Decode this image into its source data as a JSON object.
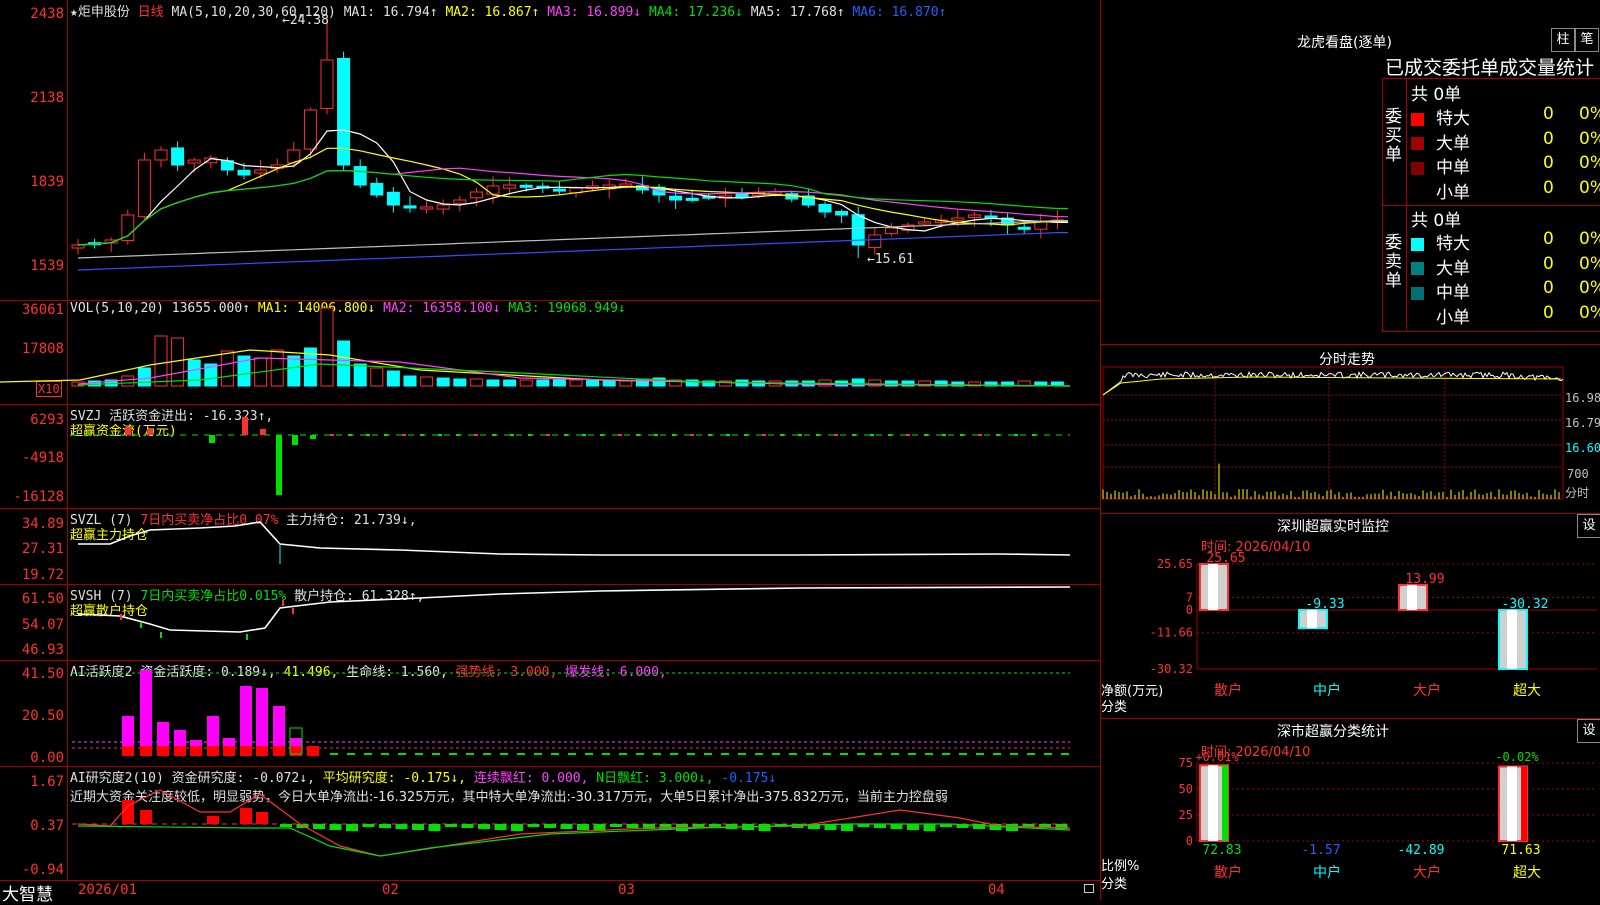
{
  "stock": {
    "name": "炬申股份",
    "period": "日线"
  },
  "kline": {
    "yticks": [
      "2438",
      "2138",
      "1839",
      "1539"
    ],
    "ma_params": "MA(5,10,20,30,60,120)",
    "ma1": "MA1: 16.794↑",
    "ma2": "MA2: 16.867↑",
    "ma3": "MA3: 16.899↓",
    "ma4": "MA4: 17.236↓",
    "ma5": "MA5: 17.768↑",
    "ma6": "MA6: 16.870↑",
    "high_label": "24.38",
    "low_label": "15.61"
  },
  "vol": {
    "yticks": [
      "36061",
      "17808"
    ],
    "unit": "X10",
    "params": "VOL(5,10,20)",
    "val": "13655.000↑",
    "ma1": "MA1: 14006.800↓",
    "ma2": "MA2: 16358.100↓",
    "ma3": "MA3: 19068.949↓"
  },
  "svzj": {
    "yticks": [
      "6293",
      "-4918",
      "-16128"
    ],
    "title": "SVZJ",
    "desc": "活跃资金进出: -16.323↑,",
    "label": "超赢资金流(万元)"
  },
  "svzl": {
    "yticks": [
      "34.89",
      "27.31",
      "19.72"
    ],
    "title": "SVZL (7)",
    "ratio": "7日内买卖净占比0.07%",
    "hold": "主力持仓: 21.739↓,",
    "label": "超赢主力持仓"
  },
  "svsh": {
    "yticks": [
      "61.50",
      "54.07",
      "46.93"
    ],
    "title": "SVSH (7)",
    "ratio": "7日内买卖净占比0.015%",
    "hold": "散户持仓: 61.328↑,",
    "label": "超赢散户持仓"
  },
  "ai1": {
    "yticks": [
      "41.50",
      "20.50",
      "0.00"
    ],
    "title": "AI活跃度2",
    "act": "资金活跃度: 0.189↓,",
    "v2": "41.496,",
    "life": "生命线: 1.560,",
    "strong": "强势线: 3.000,",
    "burst": "爆发线: 6.000,"
  },
  "ai2": {
    "yticks": [
      "1.67",
      "0.37",
      "-0.94"
    ],
    "title": "AI研究度2(10)",
    "res": "资金研究度: -0.072↓,",
    "avg": "平均研究度: -0.175↓,",
    "cont": "连续飘红: 0.000,",
    "nday": "N日飘红: 3.000↓,",
    "last": "-0.175↓",
    "comment": "近期大资金关注度较低，明显弱势，今日大单净流出:-16.325万元，其中特大单净流出:-30.317万元，大单5日累计净出-375.832万元，当前主力控盘弱"
  },
  "xaxis": {
    "labels": [
      "2026/01",
      "02",
      "03",
      "04"
    ],
    "brand": "大智慧"
  },
  "dragon": {
    "title": "龙虎看盘(逐单)",
    "btn1": "柱",
    "btn2": "笔",
    "header": "已成交委托单成交量统计",
    "buy_total": "共 0单",
    "sell_total": "共 0单",
    "buy_side": "委买单",
    "sell_side": "委卖单",
    "buy_rows": [
      {
        "name": "特大",
        "num": "0",
        "pct": "0%",
        "color": "#ff0000"
      },
      {
        "name": "大单",
        "num": "0",
        "pct": "0%",
        "color": "#a00000"
      },
      {
        "name": "中单",
        "num": "0",
        "pct": "0%",
        "color": "#800000"
      },
      {
        "name": "小单",
        "num": "0",
        "pct": "0%",
        "color": "#000000"
      }
    ],
    "sell_rows": [
      {
        "name": "特大",
        "num": "0",
        "pct": "0%",
        "color": "#00ffff"
      },
      {
        "name": "大单",
        "num": "0",
        "pct": "0%",
        "color": "#008080"
      },
      {
        "name": "中单",
        "num": "0",
        "pct": "0%",
        "color": "#007070"
      },
      {
        "name": "小单",
        "num": "0",
        "pct": "0%",
        "color": "#000000"
      }
    ]
  },
  "timeshare": {
    "title": "分时走势",
    "yticks": [
      "16.98",
      "16.79",
      "16.60"
    ],
    "vol_label": "700",
    "vol_unit": "分时"
  },
  "monitor": {
    "title": "深圳超赢实时监控",
    "settings": "设",
    "time": "时间: 2026/04/10",
    "yticks": [
      "25.65",
      "7",
      "0",
      "-11.66",
      "-30.32"
    ],
    "ylabel": "净额(万元)",
    "xlabel": "分类",
    "cats": [
      "散户",
      "中户",
      "大户",
      "超大"
    ],
    "values": [
      25.65,
      -9.33,
      13.99,
      -30.32
    ],
    "value_labels": [
      "25.65",
      "-9.33",
      "13.99",
      "-30.32"
    ]
  },
  "classify": {
    "title": "深市超赢分类统计",
    "settings": "设",
    "time": "时间: 2026/04/10",
    "yticks": [
      "75",
      "50",
      "25",
      "0"
    ],
    "ylabel": "比例%",
    "xlabel": "分类",
    "top_labels": [
      "+0.01%",
      "-0.02%"
    ],
    "cats": [
      "散户",
      "中户",
      "大户",
      "超大"
    ],
    "bottom": [
      "72.83",
      "-1.57",
      "-42.89",
      "71.63"
    ]
  },
  "colors": {
    "up": "#ff3030",
    "down": "#00ffff",
    "grid": "#a00000"
  }
}
